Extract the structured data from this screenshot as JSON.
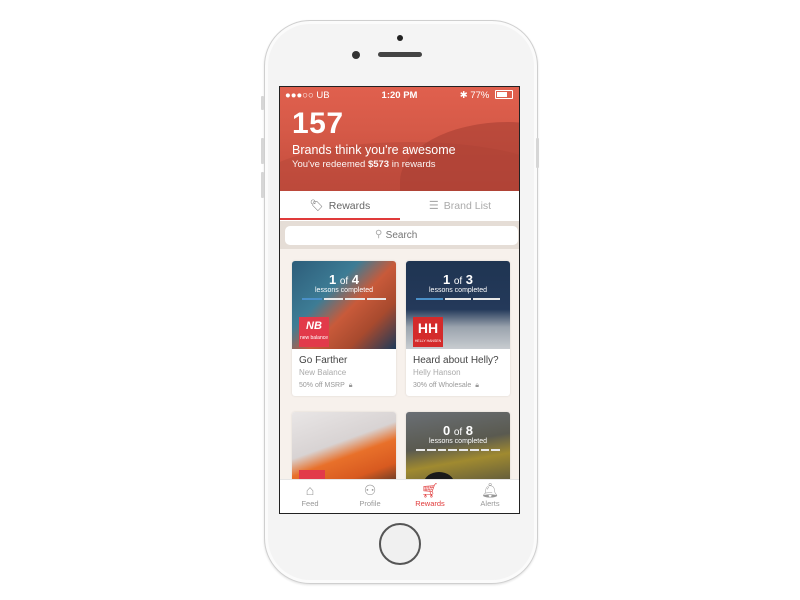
{
  "status_bar": {
    "carrier": "●●●○○ UB",
    "time": "1:20 PM",
    "battery": "77%"
  },
  "hero": {
    "count": "157",
    "headline": "Brands think you're awesome",
    "sub_prefix": "You've redeemed ",
    "amount": "$573",
    "sub_suffix": " in rewards",
    "colors": {
      "primary": "#d65a48"
    }
  },
  "tabs": [
    {
      "label": "Rewards",
      "icon": "tag-icon",
      "active": true
    },
    {
      "label": "Brand List",
      "icon": "list-icon",
      "active": false
    }
  ],
  "search": {
    "placeholder": "Search"
  },
  "cards": [
    {
      "completed": "1",
      "of": "of",
      "total": "4",
      "progress_label": "lessons completed",
      "progress": [
        1,
        0,
        0,
        0
      ],
      "logo": "NB",
      "logo_sub": "new balance",
      "title": "Go Farther",
      "brand": "New Balance",
      "deal": "50% off MSRP"
    },
    {
      "completed": "1",
      "of": "of",
      "total": "3",
      "progress_label": "lessons completed",
      "progress": [
        1,
        0,
        0
      ],
      "logo": "HH",
      "logo_sub": "HELLY HANSEN",
      "title": "Heard about Helly?",
      "brand": "Helly Hanson",
      "deal": "30% off Wholesale"
    },
    {
      "completed": "",
      "total": "",
      "title": "",
      "brand": "",
      "deal": ""
    },
    {
      "completed": "0",
      "of": "of",
      "total": "8",
      "progress_label": "lessons completed",
      "progress": [
        0,
        0,
        0,
        0,
        0,
        0,
        0,
        0
      ]
    }
  ],
  "tabbar": [
    {
      "label": "Feed",
      "icon": "home-icon",
      "active": false
    },
    {
      "label": "Profile",
      "icon": "profile-icon",
      "active": false
    },
    {
      "label": "Rewards",
      "icon": "cart-icon",
      "active": true
    },
    {
      "label": "Alerts",
      "icon": "bell-icon",
      "active": false
    }
  ],
  "accent_color": "#e03a3a"
}
